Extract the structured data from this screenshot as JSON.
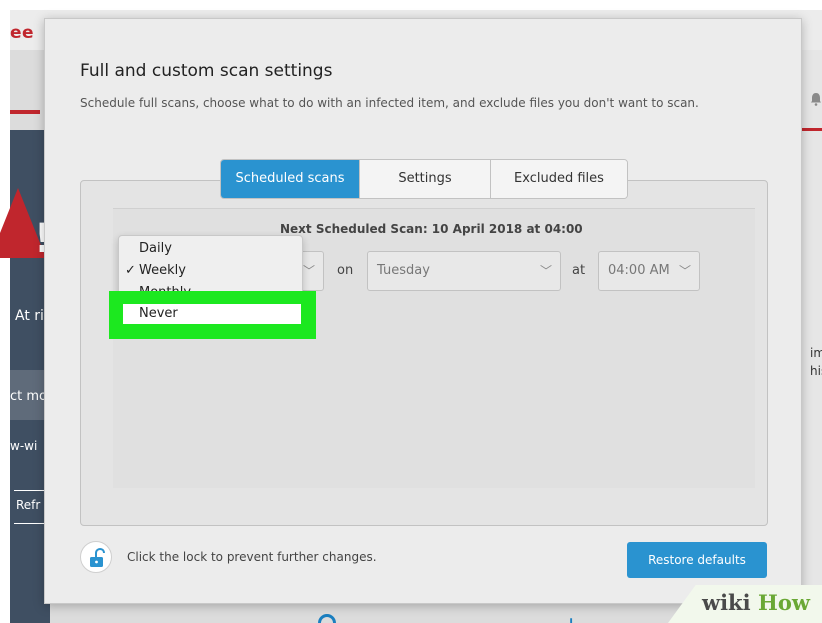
{
  "background_app": {
    "brand": "ee",
    "status_text": "At ri",
    "protect_button": "ct mo",
    "how_text": "w-wi",
    "refresh_button": "Refr",
    "right_text_1": "ime",
    "right_text_2": "his",
    "brand_color": "#c0262d"
  },
  "dialog": {
    "title": "Full and custom scan settings",
    "subtitle": "Schedule full scans, choose what to do with an infected item, and exclude files you don't want to scan.",
    "tabs": [
      {
        "label": "Scheduled scans",
        "active": true
      },
      {
        "label": "Settings",
        "active": false
      },
      {
        "label": "Excluded files",
        "active": false
      }
    ],
    "next_scan": "Next Scheduled Scan: 10 April 2018 at 04:00",
    "on_label": "on",
    "day_value": "Tuesday",
    "at_label": "at",
    "time_value": "04:00 AM",
    "frequency_menu": {
      "items": [
        "Daily",
        "Weekly",
        "Monthly",
        "Never"
      ],
      "selected": "Weekly",
      "highlighted": "Never"
    },
    "lock_text": "Click the lock to prevent further changes.",
    "restore_button": "Restore defaults",
    "accent_color": "#2a93d0",
    "highlight_color": "#1ce81f"
  },
  "watermark": {
    "part1": "wiki",
    "part2": "How"
  },
  "icons": {
    "check": "✓",
    "chevron": "﹀",
    "lock": "unlock-icon",
    "bell": "bell-icon"
  }
}
